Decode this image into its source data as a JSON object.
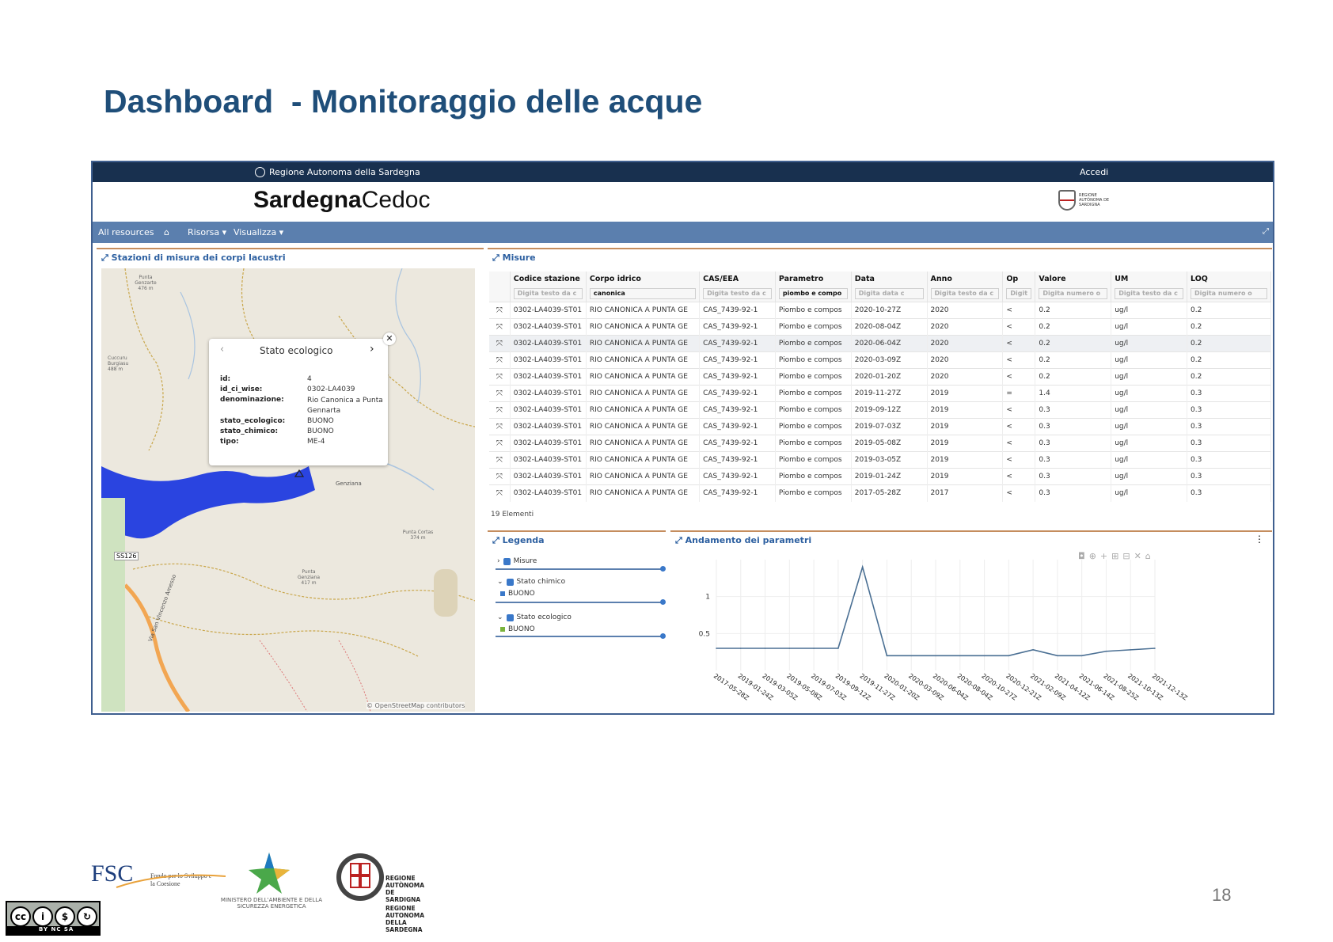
{
  "slide": {
    "title": "Dashboard  - Monitoraggio delle acque",
    "page_number": "18"
  },
  "topbar": {
    "region": "Regione Autonoma della Sardegna",
    "login": "Accedi"
  },
  "brand": {
    "bold": "Sardegna",
    "light": "Cedoc"
  },
  "navbar": {
    "all_resources": "All resources",
    "resource": "Risorsa ▾",
    "visualize": "Visualizza ▾"
  },
  "map_panel": {
    "title": "Stazioni di misura dei corpi lacustri",
    "attribution": "© OpenStreetMap contributors",
    "road": "SS126",
    "labels": [
      "Punta Genzarte 476 m",
      "Cuccuru Burgiasu 488 m",
      "Punta Cortas 374 m",
      "Punta Genziana 417 m",
      "Genziana",
      "Via San Vincenzo Amesso"
    ],
    "popup": {
      "title": "Stato ecologico",
      "fields": [
        {
          "key": "id:",
          "value": "4"
        },
        {
          "key": "id_ci_wise:",
          "value": "0302-LA4039"
        },
        {
          "key": "denominazione:",
          "value": "Rio Canonica a Punta Gennarta"
        },
        {
          "key": "stato_ecologico:",
          "value": "BUONO"
        },
        {
          "key": "stato_chimico:",
          "value": "BUONO"
        },
        {
          "key": "tipo:",
          "value": "ME-4"
        }
      ]
    }
  },
  "measures_panel": {
    "title": "Misure",
    "columns": [
      "Codice stazione",
      "Corpo idrico",
      "CAS/EEA",
      "Parametro",
      "Data",
      "Anno",
      "Op",
      "Valore",
      "UM",
      "LOQ"
    ],
    "filters": [
      "Digita testo da c",
      "canonica",
      "Digita testo da c",
      "piombo e compo",
      "Digita data c",
      "Digita testo da c",
      "Digit",
      "Digita numero o",
      "Digita testo da c",
      "Digita numero o"
    ],
    "rows": [
      [
        "0302-LA4039-ST01",
        "RIO CANONICA A PUNTA GE",
        "CAS_7439-92-1",
        "Piombo e compos",
        "2020-10-27Z",
        "2020",
        "<",
        "0.2",
        "ug/l",
        "0.2"
      ],
      [
        "0302-LA4039-ST01",
        "RIO CANONICA A PUNTA GE",
        "CAS_7439-92-1",
        "Piombo e compos",
        "2020-08-04Z",
        "2020",
        "<",
        "0.2",
        "ug/l",
        "0.2"
      ],
      [
        "0302-LA4039-ST01",
        "RIO CANONICA A PUNTA GE",
        "CAS_7439-92-1",
        "Piombo e compos",
        "2020-06-04Z",
        "2020",
        "<",
        "0.2",
        "ug/l",
        "0.2"
      ],
      [
        "0302-LA4039-ST01",
        "RIO CANONICA A PUNTA GE",
        "CAS_7439-92-1",
        "Piombo e compos",
        "2020-03-09Z",
        "2020",
        "<",
        "0.2",
        "ug/l",
        "0.2"
      ],
      [
        "0302-LA4039-ST01",
        "RIO CANONICA A PUNTA GE",
        "CAS_7439-92-1",
        "Piombo e compos",
        "2020-01-20Z",
        "2020",
        "<",
        "0.2",
        "ug/l",
        "0.2"
      ],
      [
        "0302-LA4039-ST01",
        "RIO CANONICA A PUNTA GE",
        "CAS_7439-92-1",
        "Piombo e compos",
        "2019-11-27Z",
        "2019",
        "=",
        "1.4",
        "ug/l",
        "0.3"
      ],
      [
        "0302-LA4039-ST01",
        "RIO CANONICA A PUNTA GE",
        "CAS_7439-92-1",
        "Piombo e compos",
        "2019-09-12Z",
        "2019",
        "<",
        "0.3",
        "ug/l",
        "0.3"
      ],
      [
        "0302-LA4039-ST01",
        "RIO CANONICA A PUNTA GE",
        "CAS_7439-92-1",
        "Piombo e compos",
        "2019-07-03Z",
        "2019",
        "<",
        "0.3",
        "ug/l",
        "0.3"
      ],
      [
        "0302-LA4039-ST01",
        "RIO CANONICA A PUNTA GE",
        "CAS_7439-92-1",
        "Piombo e compos",
        "2019-05-08Z",
        "2019",
        "<",
        "0.3",
        "ug/l",
        "0.3"
      ],
      [
        "0302-LA4039-ST01",
        "RIO CANONICA A PUNTA GE",
        "CAS_7439-92-1",
        "Piombo e compos",
        "2019-03-05Z",
        "2019",
        "<",
        "0.3",
        "ug/l",
        "0.3"
      ],
      [
        "0302-LA4039-ST01",
        "RIO CANONICA A PUNTA GE",
        "CAS_7439-92-1",
        "Piombo e compos",
        "2019-01-24Z",
        "2019",
        "<",
        "0.3",
        "ug/l",
        "0.3"
      ],
      [
        "0302-LA4039-ST01",
        "RIO CANONICA A PUNTA GE",
        "CAS_7439-92-1",
        "Piombo e compos",
        "2017-05-28Z",
        "2017",
        "<",
        "0.3",
        "ug/l",
        "0.3"
      ]
    ],
    "count": "19 Elementi"
  },
  "legend_panel": {
    "title": "Legenda",
    "layers": [
      {
        "name": "Misure",
        "class": ""
      },
      {
        "name": "Stato chimico",
        "class": "BUONO"
      },
      {
        "name": "Stato ecologico",
        "class": "BUONO"
      }
    ],
    "colors": {
      "chimico": "#3a78c9",
      "ecologico": "#7ab33c"
    }
  },
  "chart_panel": {
    "title": "Andamento dei parametri"
  },
  "chart_data": {
    "type": "line",
    "title": "",
    "xlabel": "",
    "ylabel": "",
    "x": [
      "2017-05-28Z",
      "2019-01-24Z",
      "2019-03-05Z",
      "2019-05-08Z",
      "2019-07-03Z",
      "2019-09-12Z",
      "2019-11-27Z",
      "2020-01-20Z",
      "2020-03-09Z",
      "2020-06-04Z",
      "2020-08-04Z",
      "2020-10-27Z",
      "2020-12-21Z",
      "2021-02-09Z",
      "2021-04-12Z",
      "2021-06-14Z",
      "2021-08-25Z",
      "2021-10-13Z",
      "2021-12-13Z"
    ],
    "series": [
      {
        "values": [
          0.3,
          0.3,
          0.3,
          0.3,
          0.3,
          0.3,
          1.4,
          0.2,
          0.2,
          0.2,
          0.2,
          0.2,
          0.2,
          0.28,
          0.2,
          0.2,
          0.26,
          0.28,
          0.3
        ]
      }
    ],
    "y_ticks": [
      "0.5",
      "1"
    ],
    "ylim": [
      0,
      1.5
    ],
    "grid": true,
    "line_color": "#4a6f93"
  },
  "footer": {
    "fsc": "FSC",
    "fsc_sub": "Fondo per lo Sviluppo e la Coesione",
    "ministry": "MINISTERO DELL'AMBIENTE E DELLA SICUREZZA ENERGETICA",
    "region_sard": "REGIONE AUTÒNOMA DE SARDIGNA",
    "region_it": "REGIONE AUTONOMA DELLA SARDEGNA",
    "license": "BY  NC  SA"
  }
}
